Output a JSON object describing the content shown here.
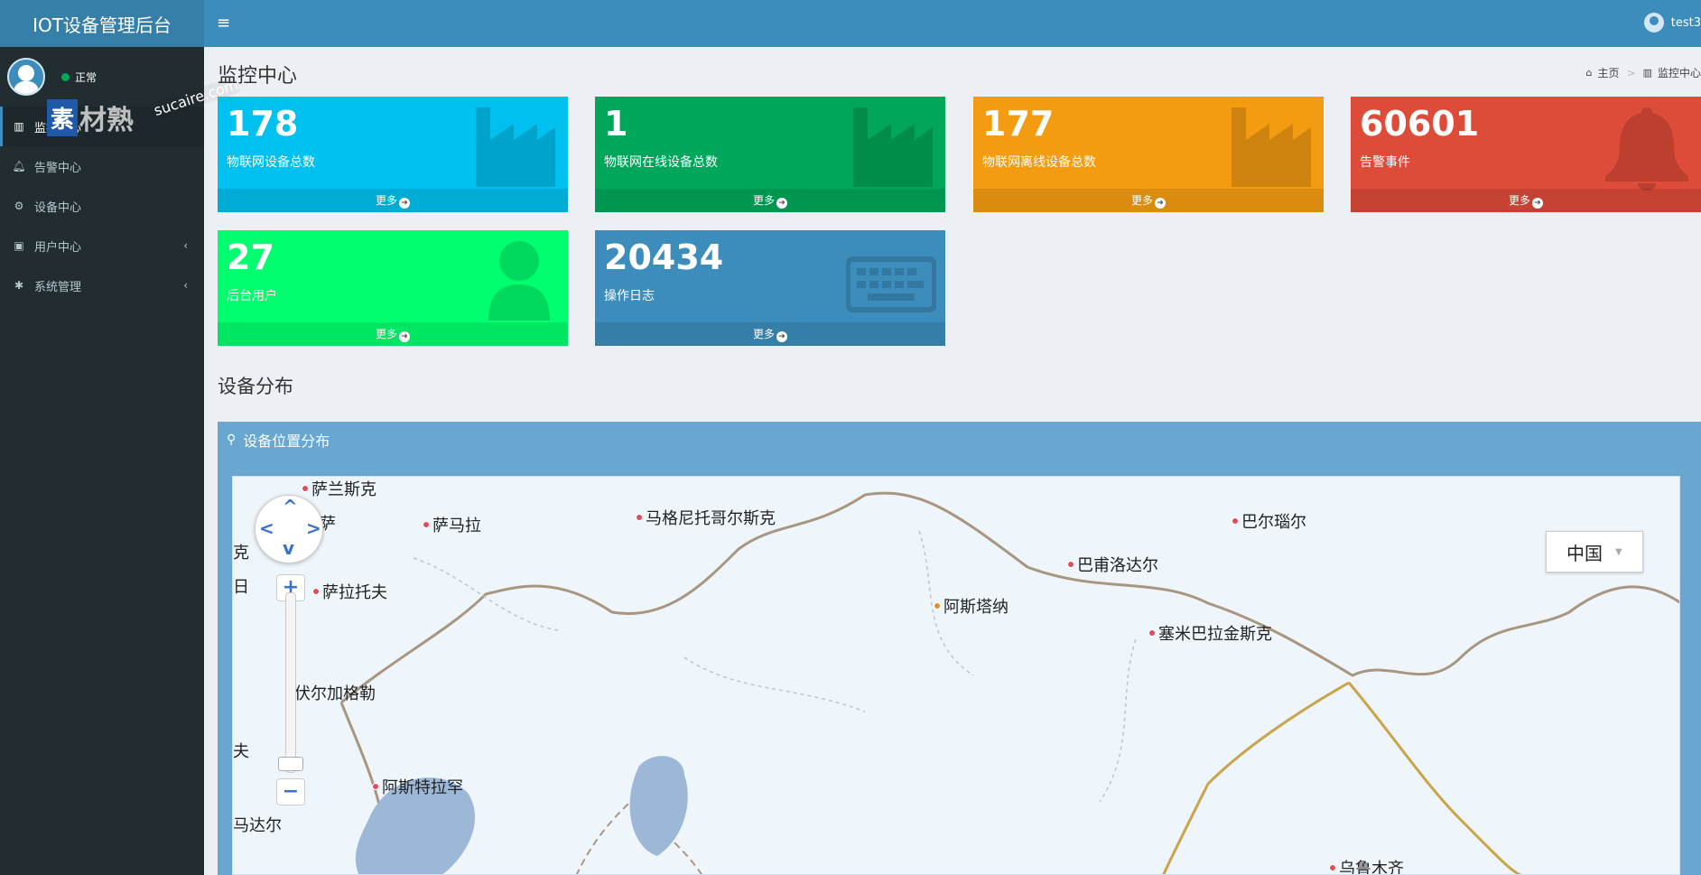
{
  "sidebar": {
    "brand": "IOT设备管理后台",
    "status": "正常",
    "items": [
      {
        "label": "监控中心",
        "icon": "chart-icon"
      },
      {
        "label": "告警中心",
        "icon": "bell-icon"
      },
      {
        "label": "设备中心",
        "icon": "cubes-icon"
      },
      {
        "label": "用户中心",
        "icon": "lock-icon",
        "caret": "‹"
      },
      {
        "label": "系统管理",
        "icon": "gear-icon",
        "caret": "‹"
      }
    ]
  },
  "watermark": {
    "box": "素",
    "text": "材熟",
    "url": "sucaire.com"
  },
  "header": {
    "toggle": "≡",
    "username": "test3"
  },
  "page": {
    "title": "监控中心",
    "breadcrumb": {
      "home": "主页",
      "current": "监控中心"
    }
  },
  "cards": [
    {
      "value": "178",
      "label": "物联网设备总数",
      "more": "更多",
      "color": "#00c0ef",
      "icon": "factory-icon"
    },
    {
      "value": "1",
      "label": "物联网在线设备总数",
      "more": "更多",
      "color": "#00a65a",
      "icon": "factory-icon"
    },
    {
      "value": "177",
      "label": "物联网离线设备总数",
      "more": "更多",
      "color": "#f39c12",
      "icon": "factory-icon"
    },
    {
      "value": "60601",
      "label": "告警事件",
      "more": "更多",
      "color": "#dd4b39",
      "icon": "bell-icon"
    },
    {
      "value": "27",
      "label": "后台用户",
      "more": "更多",
      "color": "#00ff6e",
      "icon": "user-icon"
    },
    {
      "value": "20434",
      "label": "操作日志",
      "more": "更多",
      "color": "#3c8dbc",
      "icon": "keyboard-icon"
    }
  ],
  "section": {
    "title": "设备分布"
  },
  "map": {
    "panel_title": "设备位置分布",
    "country": "中国",
    "cities": [
      "萨兰斯克",
      "萨",
      "萨马拉",
      "马格尼托哥尔斯克",
      "巴尔瑙尔",
      "克",
      "巴甫洛达尔",
      "日",
      "萨拉托夫",
      "阿斯塔纳",
      "塞米巴拉金斯克",
      "伏尔加格勒",
      "夫",
      "阿斯特拉罕",
      "马达尔",
      "乌鲁木齐"
    ]
  }
}
